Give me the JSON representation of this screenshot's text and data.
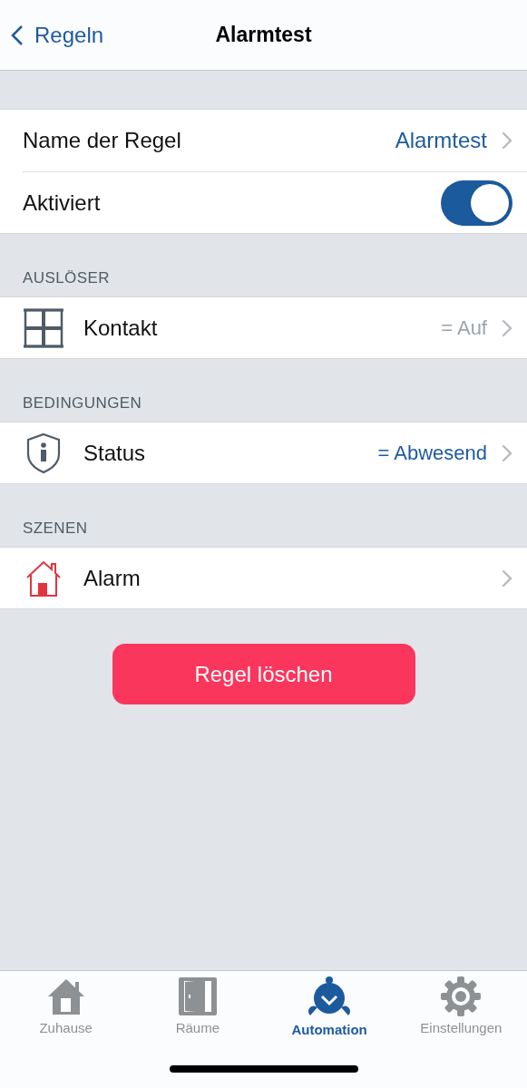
{
  "nav": {
    "back": "Regeln",
    "title": "Alarmtest"
  },
  "general": [
    {
      "kind": "link",
      "label": "Name der Regel",
      "value": "Alarmtest"
    },
    {
      "kind": "toggle",
      "label": "Aktiviert",
      "on": true
    }
  ],
  "sections": [
    {
      "header": "AUSLÖSER",
      "rows": [
        {
          "kind": "window",
          "label": "Kontakt",
          "value": "= Auf",
          "value_muted": true
        }
      ]
    },
    {
      "header": "BEDINGUNGEN",
      "rows": [
        {
          "kind": "shield",
          "label": "Status",
          "value": "= Abwesend",
          "value_muted": false
        }
      ]
    },
    {
      "header": "SZENEN",
      "rows": [
        {
          "kind": "house",
          "label": "Alarm"
        }
      ]
    }
  ],
  "delete_button": "Regel löschen",
  "tabs": [
    {
      "kind": "home",
      "label": "Zuhause",
      "selected": false
    },
    {
      "kind": "door",
      "label": "Räume",
      "selected": false
    },
    {
      "kind": "alarm",
      "label": "Automation",
      "selected": true
    },
    {
      "kind": "gear",
      "label": "Einstellungen",
      "selected": false
    }
  ]
}
